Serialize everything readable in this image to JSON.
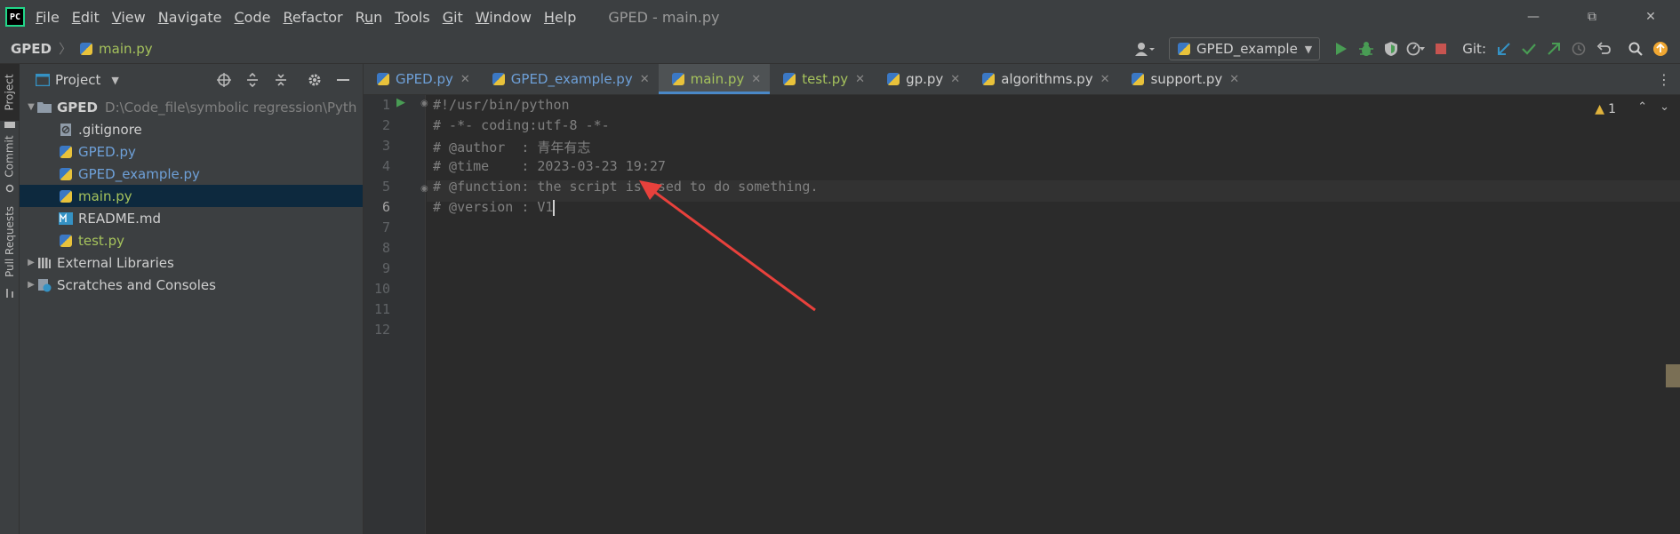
{
  "app": {
    "logo_text": "PC",
    "window_title": "GPED - main.py",
    "menus": [
      {
        "pre": "",
        "u": "F",
        "post": "ile"
      },
      {
        "pre": "",
        "u": "E",
        "post": "dit"
      },
      {
        "pre": "",
        "u": "V",
        "post": "iew"
      },
      {
        "pre": "",
        "u": "N",
        "post": "avigate"
      },
      {
        "pre": "",
        "u": "C",
        "post": "ode"
      },
      {
        "pre": "",
        "u": "R",
        "post": "efactor"
      },
      {
        "pre": "R",
        "u": "u",
        "post": "n"
      },
      {
        "pre": "",
        "u": "T",
        "post": "ools"
      },
      {
        "pre": "",
        "u": "G",
        "post": "it"
      },
      {
        "pre": "",
        "u": "W",
        "post": "indow"
      },
      {
        "pre": "",
        "u": "H",
        "post": "elp"
      }
    ]
  },
  "navbar": {
    "root": "GPED",
    "file": "main.py",
    "run_config": "GPED_example",
    "git_label": "Git:"
  },
  "tool_strip": {
    "project": "Project",
    "commit": "Commit",
    "pull_requests": "Pull Requests"
  },
  "project_panel": {
    "title": "Project",
    "root_name": "GPED",
    "root_path": "D:\\Code_file\\symbolic regression\\Pyth",
    "files": [
      {
        "name": ".gitignore",
        "kind": "git",
        "color": "gray"
      },
      {
        "name": "GPED.py",
        "kind": "py",
        "color": "blue"
      },
      {
        "name": "GPED_example.py",
        "kind": "py",
        "color": "blue"
      },
      {
        "name": "main.py",
        "kind": "py",
        "color": "green"
      },
      {
        "name": "README.md",
        "kind": "md",
        "color": "gray"
      },
      {
        "name": "test.py",
        "kind": "py",
        "color": "green"
      }
    ],
    "external_libraries": "External Libraries",
    "scratches": "Scratches and Consoles"
  },
  "tabs": [
    {
      "label": "GPED.py",
      "color": "#6ea0d8"
    },
    {
      "label": "GPED_example.py",
      "color": "#6ea0d8"
    },
    {
      "label": "main.py",
      "color": "#a5c25c"
    },
    {
      "label": "test.py",
      "color": "#a5c25c"
    },
    {
      "label": "gp.py",
      "color": "#cfcfcf"
    },
    {
      "label": "algorithms.py",
      "color": "#cfcfcf"
    },
    {
      "label": "support.py",
      "color": "#cfcfcf"
    }
  ],
  "editor": {
    "warning_count": "1",
    "line_numbers": [
      "1",
      "2",
      "3",
      "4",
      "5",
      "6",
      "7",
      "8",
      "9",
      "10",
      "11",
      "12"
    ],
    "lines": [
      "#!/usr/bin/python",
      "# -*- coding:utf-8 -*-",
      "# @author  : 青年有志",
      "# @time    : 2023-03-23 19:27",
      "# @function: the script is used to do something.",
      "# @version : V1"
    ]
  },
  "colors": {
    "accent": "#4a88c7",
    "modified_green": "#a5c25c",
    "vcs_blue": "#6ea0d8",
    "annotation_red": "#e8413c"
  }
}
